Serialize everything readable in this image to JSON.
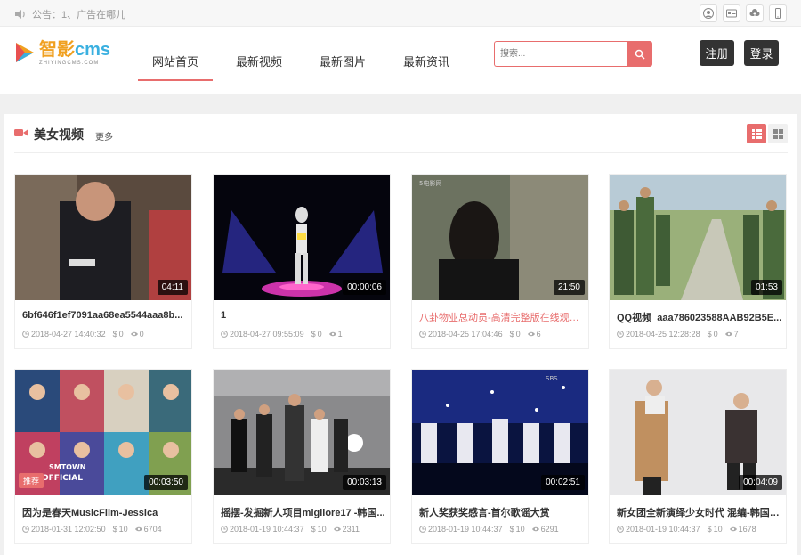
{
  "notice": "公告：1、广告在哪儿",
  "top_icons": [
    "user-icon",
    "id-card-icon",
    "cloud-upload-icon",
    "mobile-icon"
  ],
  "logo": {
    "main": "智影",
    "cms": "cms",
    "sub": "ZHIYINGCMS.COM"
  },
  "nav": [
    {
      "label": "网站首页",
      "active": true
    },
    {
      "label": "最新视频",
      "active": false
    },
    {
      "label": "最新图片",
      "active": false
    },
    {
      "label": "最新资讯",
      "active": false
    }
  ],
  "search": {
    "placeholder": "搜索..."
  },
  "buttons": {
    "register": "注册",
    "login": "登录"
  },
  "section": {
    "title": "美女视频",
    "more": "更多"
  },
  "colors": {
    "accent": "#e86d6d",
    "dark_button": "#333333"
  },
  "videos": [
    {
      "title": "6bf646f1ef7091aa68ea5544aaa8b...",
      "date": "2018-04-27 14:40:32",
      "price": "0",
      "views": "0",
      "duration": "04:11",
      "highlight": false,
      "badge": ""
    },
    {
      "title": "1",
      "date": "2018-04-27 09:55:09",
      "price": "0",
      "views": "1",
      "duration": "00:00:06",
      "highlight": false,
      "badge": ""
    },
    {
      "title": "八卦物业总动员-高清完整版在线观看-...",
      "date": "2018-04-25 17:04:46",
      "price": "0",
      "views": "6",
      "duration": "21:50",
      "highlight": true,
      "badge": ""
    },
    {
      "title": "QQ视频_aaa786023588AAB92B5E...",
      "date": "2018-04-25 12:28:28",
      "price": "0",
      "views": "7",
      "duration": "01:53",
      "highlight": false,
      "badge": ""
    },
    {
      "title": "因为是春天MusicFilm-Jessica",
      "date": "2018-01-31 12:02:50",
      "price": "10",
      "views": "6704",
      "duration": "00:03:50",
      "highlight": false,
      "badge": "推荐"
    },
    {
      "title": "摇摆-发掘新人项目migliore17 -韩国...",
      "date": "2018-01-19 10:44:37",
      "price": "10",
      "views": "2311",
      "duration": "00:03:13",
      "highlight": false,
      "badge": ""
    },
    {
      "title": "新人奖获奖感言-首尔歌谣大赏",
      "date": "2018-01-19 10:44:37",
      "price": "10",
      "views": "6291",
      "duration": "00:02:51",
      "highlight": false,
      "badge": ""
    },
    {
      "title": "新女团全新演绎少女时代 混编-韩国视...",
      "date": "2018-01-19 10:44:37",
      "price": "10",
      "views": "1678",
      "duration": "00:04:09",
      "highlight": false,
      "badge": ""
    }
  ]
}
